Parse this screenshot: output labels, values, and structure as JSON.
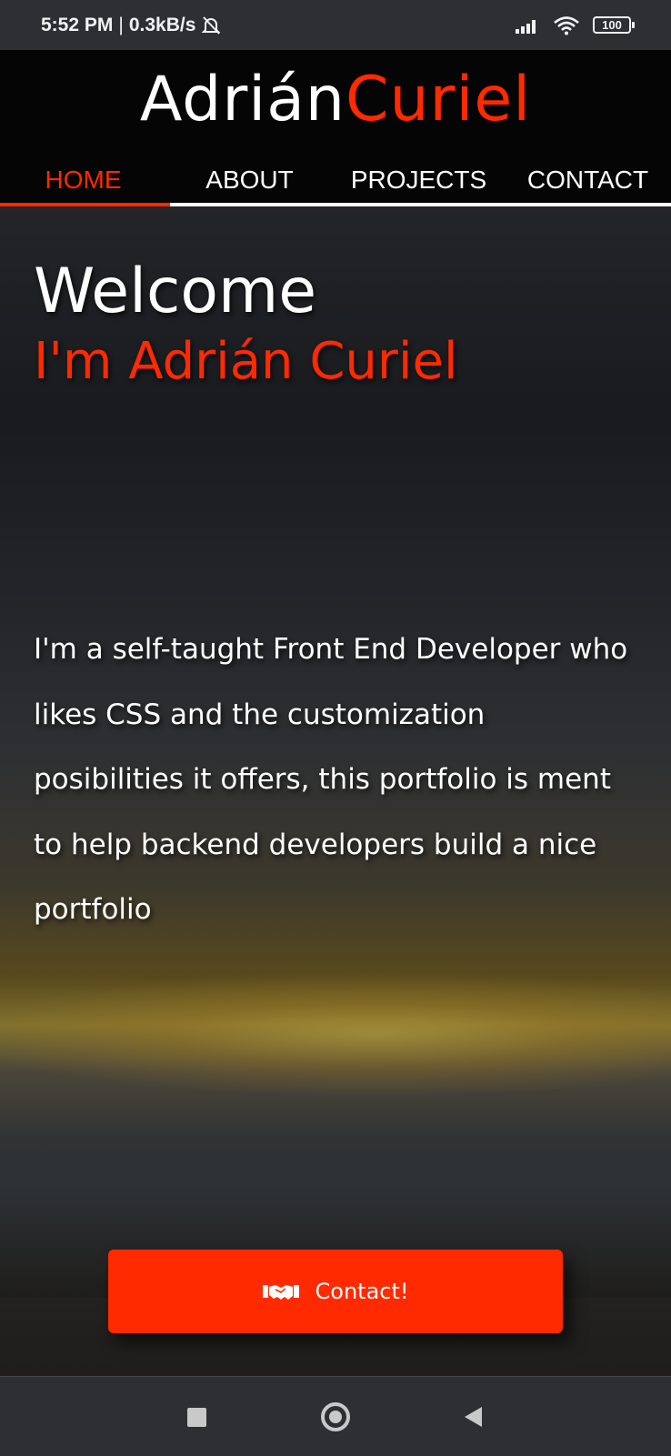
{
  "status_bar": {
    "time": "5:52 PM",
    "separator": "|",
    "net_speed": "0.3kB/s",
    "battery": "100",
    "icons": [
      "mute-bell-icon",
      "signal-icon",
      "wifi-icon",
      "battery-icon"
    ]
  },
  "header": {
    "logo_first": "Adrián",
    "logo_last": "Curiel",
    "nav": [
      {
        "label": "HOME",
        "active": true
      },
      {
        "label": "ABOUT",
        "active": false
      },
      {
        "label": "PROJECTS",
        "active": false
      },
      {
        "label": "CONTACT",
        "active": false
      }
    ]
  },
  "hero": {
    "welcome": "Welcome",
    "subtitle": "I'm Adrián Curiel",
    "bio": "I'm a self-taught Front End Developer who likes CSS and the customization posibilities it offers, this portfolio is ment to help backend developers build a nice portfolio",
    "contact_button": {
      "label": "Contact!",
      "icon": "handshake-icon"
    }
  },
  "system_nav": {
    "buttons": [
      "recents-icon",
      "home-icon",
      "back-icon"
    ]
  },
  "colors": {
    "accent": "#ff2a00",
    "header_bg": "#050506",
    "text": "#ffffff",
    "system_bar": "#2e2f33"
  }
}
